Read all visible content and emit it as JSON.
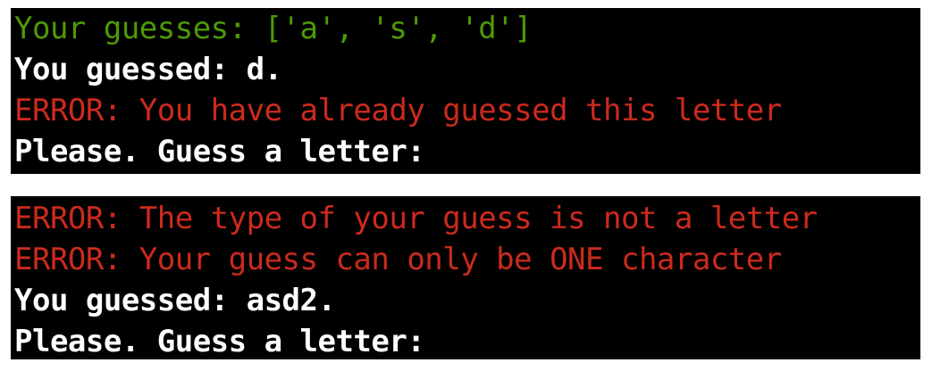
{
  "colors": {
    "background": "#000000",
    "info": "#4e9a06",
    "error": "#cc2a1e",
    "text": "#ffffff"
  },
  "terminal_1": {
    "lines": [
      "Your guesses: ['a', 's', 'd']",
      "You guessed: d.",
      "ERROR: You have already guessed this letter",
      "Please. Guess a letter:"
    ]
  },
  "terminal_2": {
    "lines": [
      "ERROR: The type of your guess is not a letter",
      "ERROR: Your guess can only be ONE character",
      "You guessed: asd2.",
      "Please. Guess a letter:"
    ]
  }
}
